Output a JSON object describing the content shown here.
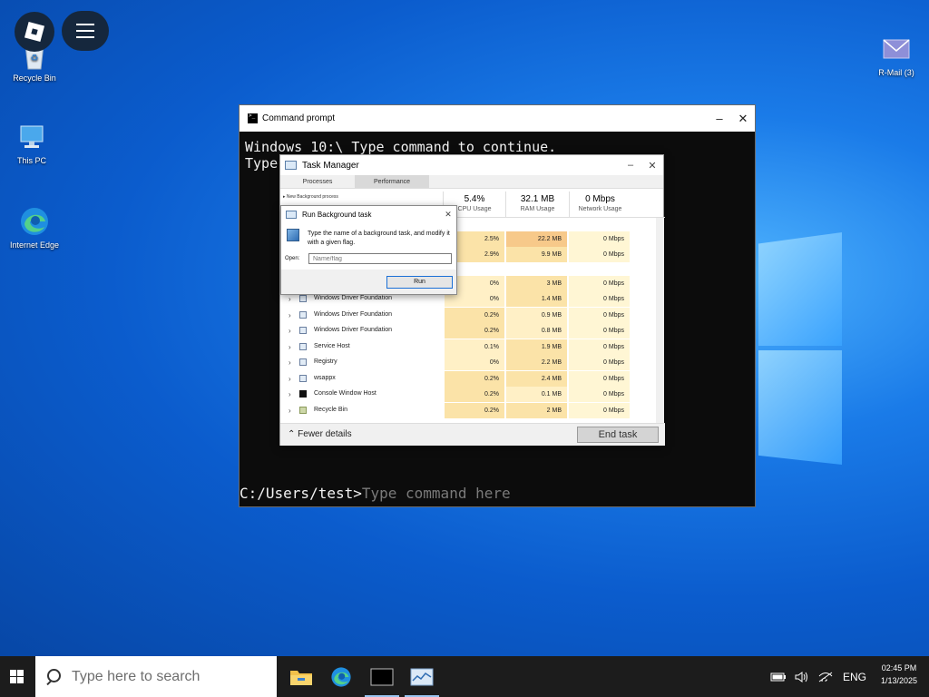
{
  "desktop": {
    "icons": [
      {
        "label": "Recycle Bin"
      },
      {
        "label": "This PC"
      },
      {
        "label": "Internet Edge"
      },
      {
        "label": "R-Mail (3)"
      }
    ]
  },
  "cmd": {
    "title": "Command prompt",
    "line1": "Windows 10:\\ Type command to continue.",
    "line2": "Type",
    "prompt": "C:/Users/test>",
    "input_placeholder": "Type command here",
    "minimize": "–",
    "close": "✕"
  },
  "task_manager": {
    "title": "Task Manager",
    "minimize": "–",
    "close": "✕",
    "tabs": [
      "Processes",
      "Performance"
    ],
    "new_bg": "▸ New Background process",
    "columns": [
      {
        "pct": "5.4%",
        "label": "CPU Usage"
      },
      {
        "pct": "32.1 MB",
        "label": "RAM Usage"
      },
      {
        "pct": "0 Mbps",
        "label": "Network Usage"
      }
    ],
    "rows": [
      {
        "name": "",
        "cpu": "2.5%",
        "ram": "22.2 MB",
        "net": "0 Mbps"
      },
      {
        "name": "",
        "cpu": "2.9%",
        "ram": "9.9 MB",
        "net": "0 Mbps"
      },
      {
        "name": "",
        "cpu": "0%",
        "ram": "3 MB",
        "net": "0 Mbps"
      },
      {
        "name": "Windows Driver Foundation",
        "cpu": "0%",
        "ram": "1.4 MB",
        "net": "0 Mbps"
      },
      {
        "name": "Windows Driver Foundation",
        "cpu": "0.2%",
        "ram": "0.9 MB",
        "net": "0 Mbps"
      },
      {
        "name": "Windows Driver Foundation",
        "cpu": "0.2%",
        "ram": "0.8 MB",
        "net": "0 Mbps"
      },
      {
        "name": "Service Host",
        "cpu": "0.1%",
        "ram": "1.9 MB",
        "net": "0 Mbps"
      },
      {
        "name": "Registry",
        "cpu": "0%",
        "ram": "2.2 MB",
        "net": "0 Mbps"
      },
      {
        "name": "wsappx",
        "cpu": "0.2%",
        "ram": "2.4 MB",
        "net": "0 Mbps"
      },
      {
        "name": "Console Window Host",
        "cpu": "0.2%",
        "ram": "0.1 MB",
        "net": "0 Mbps"
      },
      {
        "name": "Recycle Bin",
        "cpu": "0.2%",
        "ram": "2 MB",
        "net": "0 Mbps"
      }
    ],
    "fewer_details": "⌃ Fewer details",
    "end_task": "End task"
  },
  "run_dialog": {
    "title": "Run Background task",
    "close": "✕",
    "description": "Type the name of a background task, and modify it with a given flag.",
    "open_label": "Open:",
    "input_placeholder": "Name/flag",
    "run_label": "Run"
  },
  "taskbar": {
    "search_placeholder": "Type here to search",
    "language": "ENG",
    "time": "02:45 PM",
    "date": "1/13/2025"
  },
  "colors": {
    "taskbar": "#1c1c1c",
    "accent": "#1a6fd6",
    "ram_highlight": "#f7c98a",
    "cpu_highlight": "#fbe3a8"
  }
}
